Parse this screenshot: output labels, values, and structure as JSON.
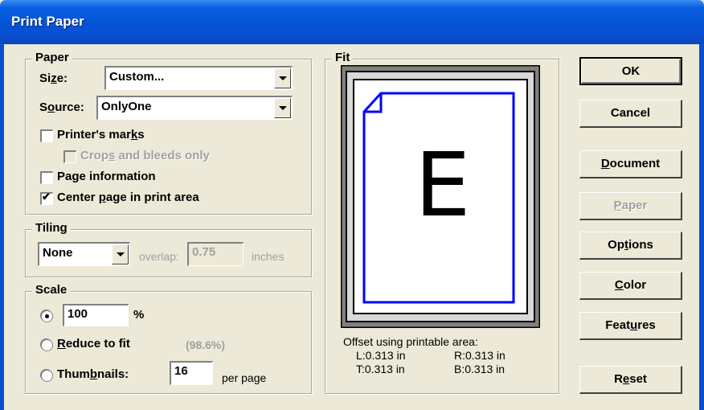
{
  "window": {
    "title": "Print Paper"
  },
  "paper": {
    "group_label": "Paper",
    "size_label": "Size:",
    "size_value": "Custom...",
    "source_label": "Source:",
    "source_value": "OnlyOne",
    "printers_marks_label": "Printer's marks",
    "printers_marks_checked": false,
    "crops_label": "Crops and bleeds only",
    "page_info_label": "Page information",
    "page_info_checked": false,
    "center_label": "Center page in print area",
    "center_checked": true
  },
  "tiling": {
    "group_label": "Tiling",
    "mode_value": "None",
    "overlap_label": "overlap:",
    "overlap_value": "0.75",
    "overlap_unit": "inches"
  },
  "scale": {
    "group_label": "Scale",
    "percent_value": "100",
    "percent_unit": "%",
    "reduce_label": "Reduce to fit",
    "reduce_value": "(98.6%)",
    "thumbnails_label": "Thumbnails:",
    "thumbnails_value": "16",
    "per_page": "per page",
    "selected": "percent"
  },
  "fit": {
    "group_label": "Fit",
    "preview_letter": "E",
    "offset_title": "Offset using printable area:",
    "left": "L:0.313 in",
    "right": "R:0.313 in",
    "top": "T:0.313 in",
    "bottom": "B:0.313 in"
  },
  "buttons": {
    "ok": "OK",
    "cancel": "Cancel",
    "document": "Document",
    "paper": "Paper",
    "options": "Options",
    "color": "Color",
    "features": "Features",
    "reset": "Reset"
  },
  "colors": {
    "title_bar": "#0553d6",
    "preview_border": "#0000ff",
    "dialog_bg": "#ece9d8"
  }
}
